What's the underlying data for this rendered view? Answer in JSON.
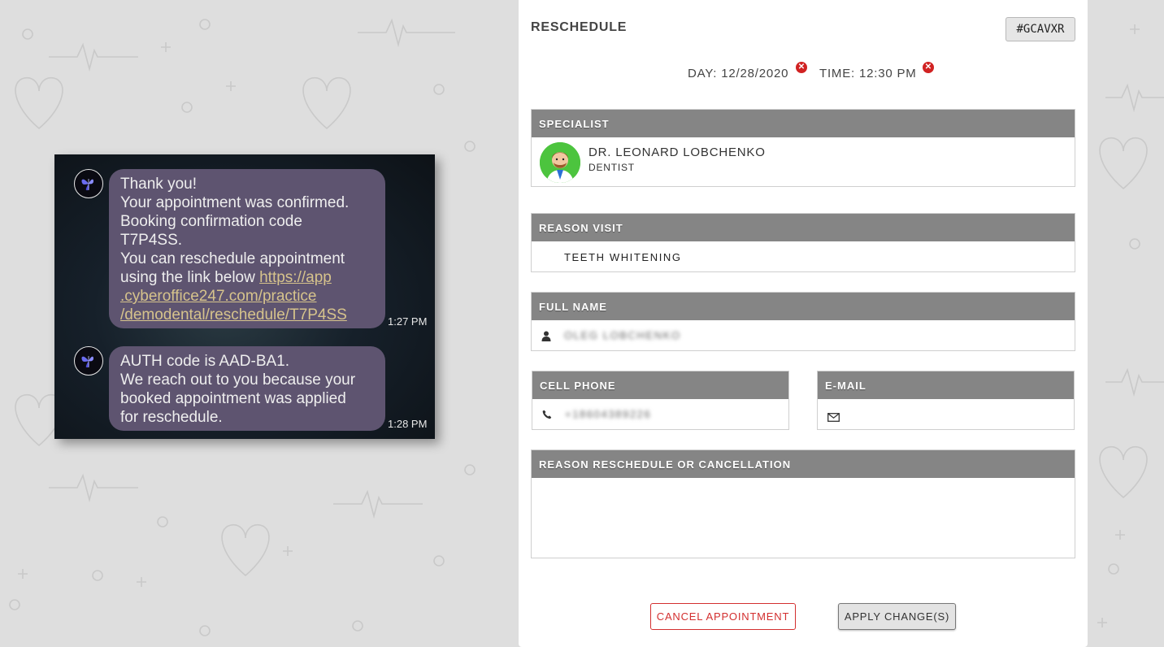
{
  "sms": {
    "messages": [
      {
        "lines": [
          {
            "text": "Thank you!"
          },
          {
            "text": "Your appointment was confirmed."
          },
          {
            "text": "Booking confirmation code"
          },
          {
            "text": "T7P4SS."
          },
          {
            "text": "You can reschedule appointment"
          },
          {
            "text": "using the link below ",
            "link": "https://app"
          },
          {
            "link": ".cyberoffice247.com/practice"
          },
          {
            "link": "/demodental/reschedule/T7P4SS"
          }
        ],
        "time": "1:27 PM"
      },
      {
        "lines": [
          {
            "text": "AUTH code is AAD-BA1."
          },
          {
            "text": "We reach out to you because your"
          },
          {
            "text": "booked appointment was applied"
          },
          {
            "text": "for reschedule."
          }
        ],
        "time": "1:28 PM"
      }
    ]
  },
  "form": {
    "title": "RESCHEDULE",
    "code": "#GCAVXR",
    "day": "DAY: 12/28/2020",
    "time": "TIME: 12:30 PM",
    "specialist": {
      "label": "SPECIALIST",
      "name": "DR. LEONARD LOBCHENKO",
      "role": "DENTIST"
    },
    "reason_visit": {
      "label": "REASON VISIT",
      "value": "TEETH WHITENING"
    },
    "full_name": {
      "label": "FULL NAME",
      "value": "OLEG LOBCHENKO"
    },
    "cell_phone": {
      "label": "CELL PHONE",
      "value": "+18604389226"
    },
    "email": {
      "label": "E-MAIL",
      "value": ""
    },
    "reason_reschedule": {
      "label": "REASON RESCHEDULE OR CANCELLATION",
      "value": ""
    },
    "cancel_label": "CANCEL APPOINTMENT",
    "apply_label": "APPLY CHANGE(S)"
  },
  "colors": {
    "accent_red": "#d32f2f",
    "header_gray": "#858585",
    "bubble": "#5e5470",
    "link": "#d6c38c"
  }
}
